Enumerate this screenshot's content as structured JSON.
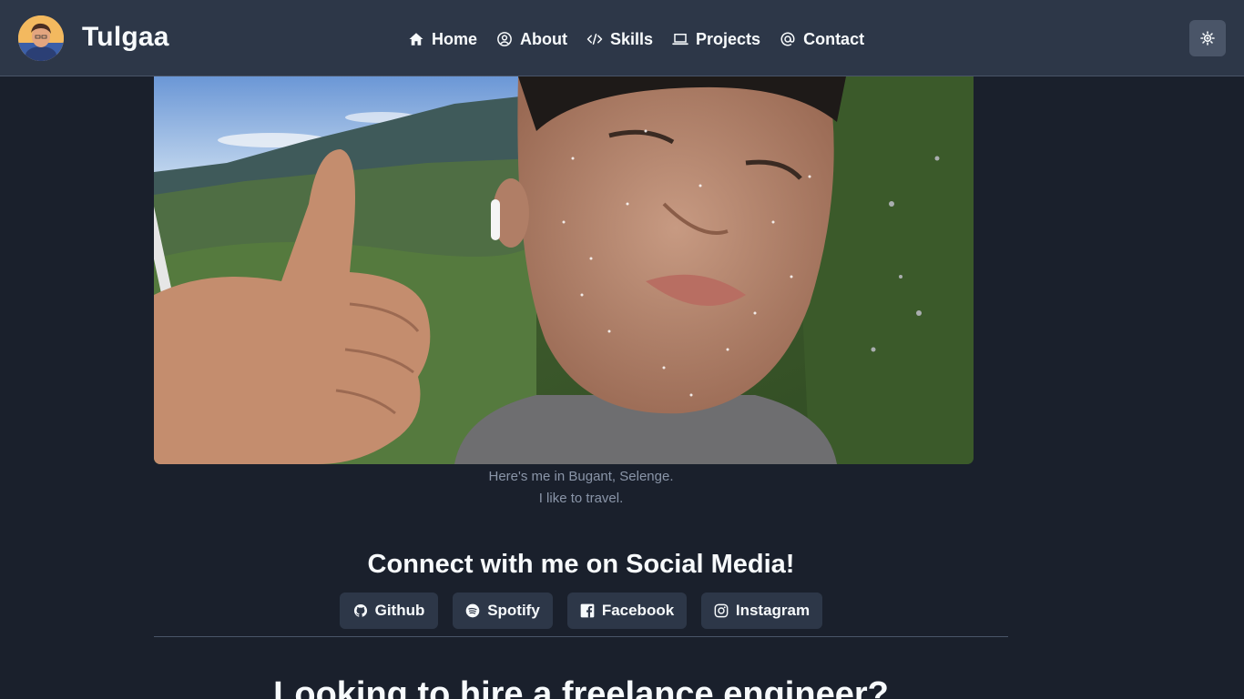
{
  "header": {
    "brand": "Tulgaa",
    "nav": [
      {
        "label": "Home",
        "icon": "home-icon"
      },
      {
        "label": "About",
        "icon": "user-circle-icon"
      },
      {
        "label": "Skills",
        "icon": "code-icon"
      },
      {
        "label": "Projects",
        "icon": "laptop-icon"
      },
      {
        "label": "Contact",
        "icon": "at-icon"
      }
    ],
    "theme_toggle_icon": "sun-icon"
  },
  "hero": {
    "caption_line1": "Here's me in Bugant, Selenge.",
    "caption_line2": "I like to travel."
  },
  "social": {
    "heading": "Connect with me on Social Media!",
    "links": [
      {
        "label": "Github",
        "icon": "github-icon"
      },
      {
        "label": "Spotify",
        "icon": "spotify-icon"
      },
      {
        "label": "Facebook",
        "icon": "facebook-icon"
      },
      {
        "label": "Instagram",
        "icon": "instagram-icon"
      }
    ]
  },
  "hire": {
    "heading": "Looking to hire a freelance engineer?"
  },
  "colors": {
    "background": "#1a202c",
    "navbar": "#2d3748",
    "button": "#2d3748",
    "text": "#f7fafc",
    "muted_text": "#8a95a8"
  }
}
